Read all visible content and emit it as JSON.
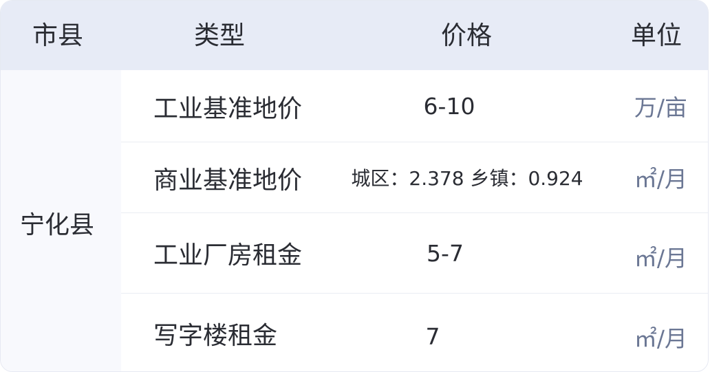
{
  "header": {
    "city": "市县",
    "type": "类型",
    "price": "价格",
    "unit": "单位"
  },
  "city": "宁化县",
  "rows": [
    {
      "type": "工业基准地价",
      "price": "6-10",
      "unit": "万/亩"
    },
    {
      "type": "商业基准地价",
      "price": "城区：2.378 乡镇：0.924",
      "unit": "㎡/月"
    },
    {
      "type": "工业厂房租金",
      "price": "5-7",
      "unit": "㎡/月"
    },
    {
      "type": "写字楼租金",
      "price": "7",
      "unit": "㎡/月"
    }
  ]
}
